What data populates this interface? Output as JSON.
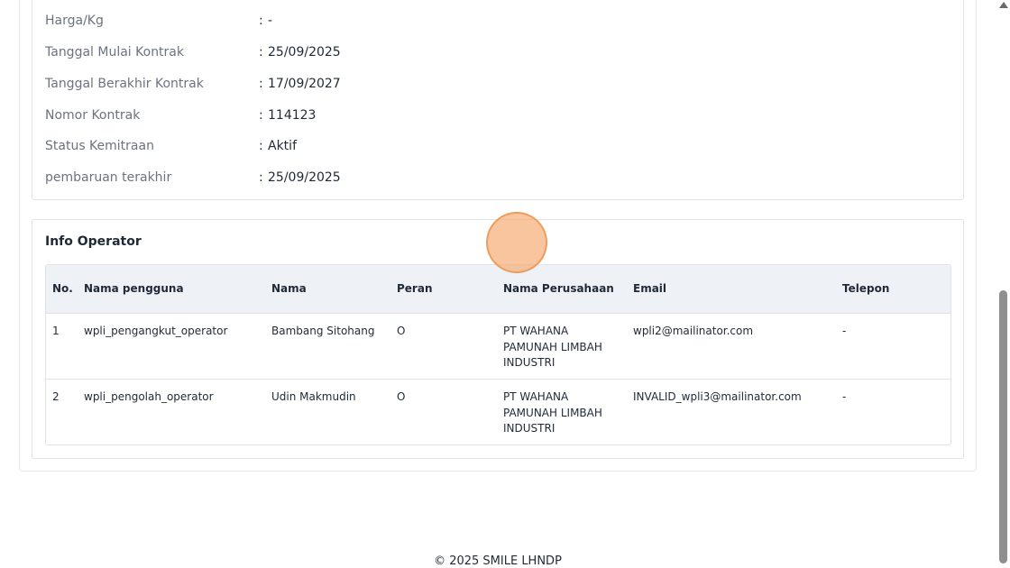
{
  "contract_info": [
    {
      "label": "Harga/Kg",
      "value": "-"
    },
    {
      "label": "Tanggal Mulai Kontrak",
      "value": "25/09/2025"
    },
    {
      "label": "Tanggal Berakhir Kontrak",
      "value": "17/09/2027"
    },
    {
      "label": "Nomor Kontrak",
      "value": "114123"
    },
    {
      "label": "Status Kemitraan",
      "value": "Aktif"
    },
    {
      "label": "pembaruan terakhir",
      "value": "25/09/2025"
    }
  ],
  "separator": ":",
  "operator": {
    "title": "Info Operator",
    "columns": [
      "No.",
      "Nama pengguna",
      "Nama",
      "Peran",
      "Nama Perusahaan",
      "Email",
      "Telepon"
    ],
    "rows": [
      {
        "no": "1",
        "username": "wpli_pengangkut_operator",
        "name": "Bambang Sitohang",
        "role": "O",
        "company": "PT WAHANA PAMUNAH LIMBAH INDUSTRI",
        "email": "wpli2@mailinator.com",
        "phone": "-"
      },
      {
        "no": "2",
        "username": "wpli_pengolah_operator",
        "name": "Udin Makmudin",
        "role": "O",
        "company": "PT WAHANA PAMUNAH LIMBAH INDUSTRI",
        "email": "INVALID_wpli3@mailinator.com",
        "phone": "-"
      }
    ]
  },
  "footer": {
    "text": "© 2025 SMILE LHNDP"
  }
}
